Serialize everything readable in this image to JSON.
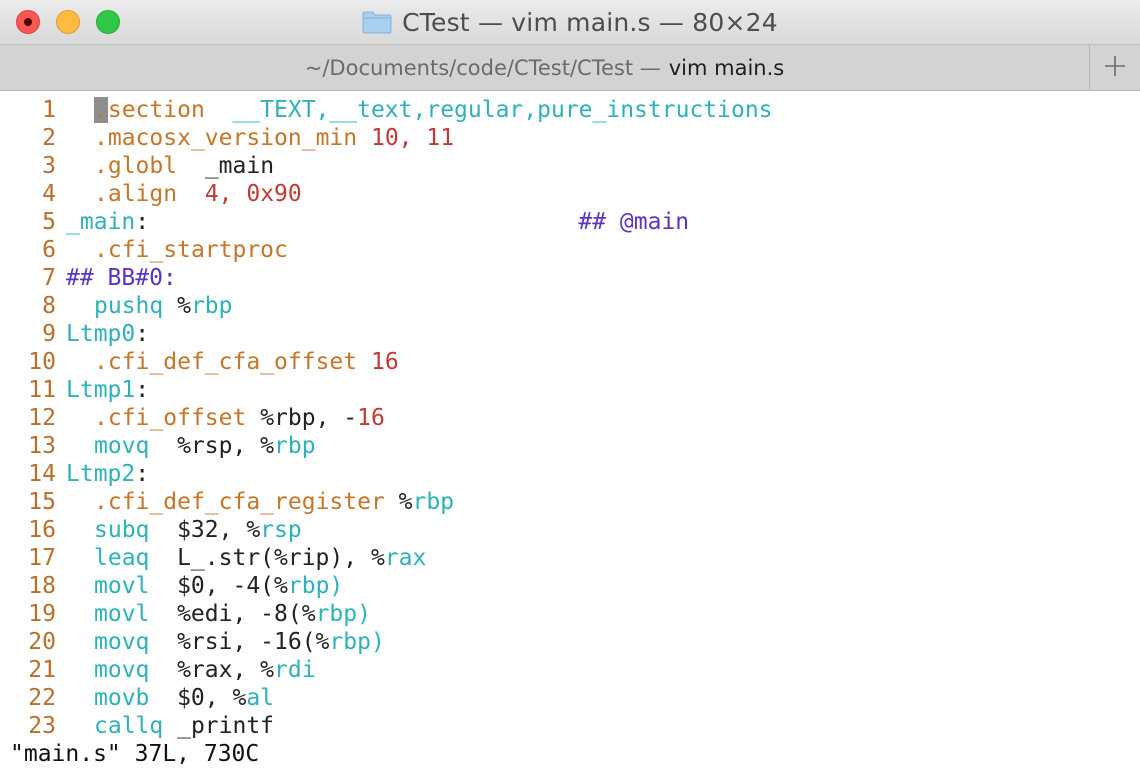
{
  "window": {
    "title": "CTest — vim main.s — 80×24",
    "tab_path": "~/Documents/code/CTest/CTest —",
    "tab_active": "vim main.s"
  },
  "editor": {
    "lines": [
      {
        "num": "1",
        "a": "",
        "b": ".",
        "c": "section",
        "d": "  __TEXT,__text,regular,pure_instructions",
        "e": ""
      },
      {
        "num": "2",
        "a": "",
        "b": ".",
        "c": "macosx_version_min",
        "d": " ",
        "e": "10, 11"
      },
      {
        "num": "3",
        "a": "",
        "b": ".",
        "c": "globl",
        "d": "  _main",
        "e": ""
      },
      {
        "num": "4",
        "a": "",
        "b": ".",
        "c": "align",
        "d": "  ",
        "e": "4, 0x90"
      },
      {
        "num": "5",
        "a": "_main",
        "b": ":",
        "c": "",
        "d": "",
        "e": "## @main"
      },
      {
        "num": "6",
        "a": "",
        "b": ".",
        "c": "cfi_startproc",
        "d": "",
        "e": ""
      },
      {
        "num": "7",
        "a": "## BB#0:",
        "b": "",
        "c": "",
        "d": "",
        "e": ""
      },
      {
        "num": "8",
        "a": "",
        "b": "",
        "c": "pushq",
        "d": " %",
        "e": "rbp"
      },
      {
        "num": "9",
        "a": "Ltmp0",
        "b": ":",
        "c": "",
        "d": "",
        "e": ""
      },
      {
        "num": "10",
        "a": "",
        "b": ".",
        "c": "cfi_def_cfa_offset",
        "d": " ",
        "e": "16"
      },
      {
        "num": "11",
        "a": "Ltmp1",
        "b": ":",
        "c": "",
        "d": "",
        "e": ""
      },
      {
        "num": "12",
        "a": "",
        "b": ".",
        "c": "cfi_offset",
        "d": " %rbp, -",
        "e": "16"
      },
      {
        "num": "13",
        "a": "",
        "b": "",
        "c": "movq",
        "d": "  %rsp, %",
        "e": "rbp"
      },
      {
        "num": "14",
        "a": "Ltmp2",
        "b": ":",
        "c": "",
        "d": "",
        "e": ""
      },
      {
        "num": "15",
        "a": "",
        "b": ".",
        "c": "cfi_def_cfa_register",
        "d": " %",
        "e": "rbp"
      },
      {
        "num": "16",
        "a": "",
        "b": "",
        "c": "subq",
        "d": "  $32, %",
        "e": "rsp"
      },
      {
        "num": "17",
        "a": "",
        "b": "",
        "c": "leaq",
        "d": "  L_.str(%rip), %",
        "e": "rax"
      },
      {
        "num": "18",
        "a": "",
        "b": "",
        "c": "movl",
        "d": "  $0, -4(%",
        "e": "rbp)"
      },
      {
        "num": "19",
        "a": "",
        "b": "",
        "c": "movl",
        "d": "  %edi, -8(%",
        "e": "rbp)"
      },
      {
        "num": "20",
        "a": "",
        "b": "",
        "c": "movq",
        "d": "  %rsi, -16(%",
        "e": "rbp)"
      },
      {
        "num": "21",
        "a": "",
        "b": "",
        "c": "movq",
        "d": "  %rax, %",
        "e": "rdi"
      },
      {
        "num": "22",
        "a": "",
        "b": "",
        "c": "movb",
        "d": "  $0, %",
        "e": "al"
      },
      {
        "num": "23",
        "a": "",
        "b": "",
        "c": "callq",
        "d": " _printf",
        "e": ""
      }
    ],
    "status": "\"main.s\" 37L, 730C"
  },
  "icons": {
    "close": "close-icon",
    "minimize": "minimize-icon",
    "zoom": "zoom-icon",
    "folder": "folder-icon",
    "add_tab": "plus-icon"
  },
  "colors": {
    "keyword": "#2fb1b9",
    "directive": "#c4762a",
    "number": "#c23a34",
    "comment": "#5a33c9",
    "line_number": "#b86f2c"
  }
}
